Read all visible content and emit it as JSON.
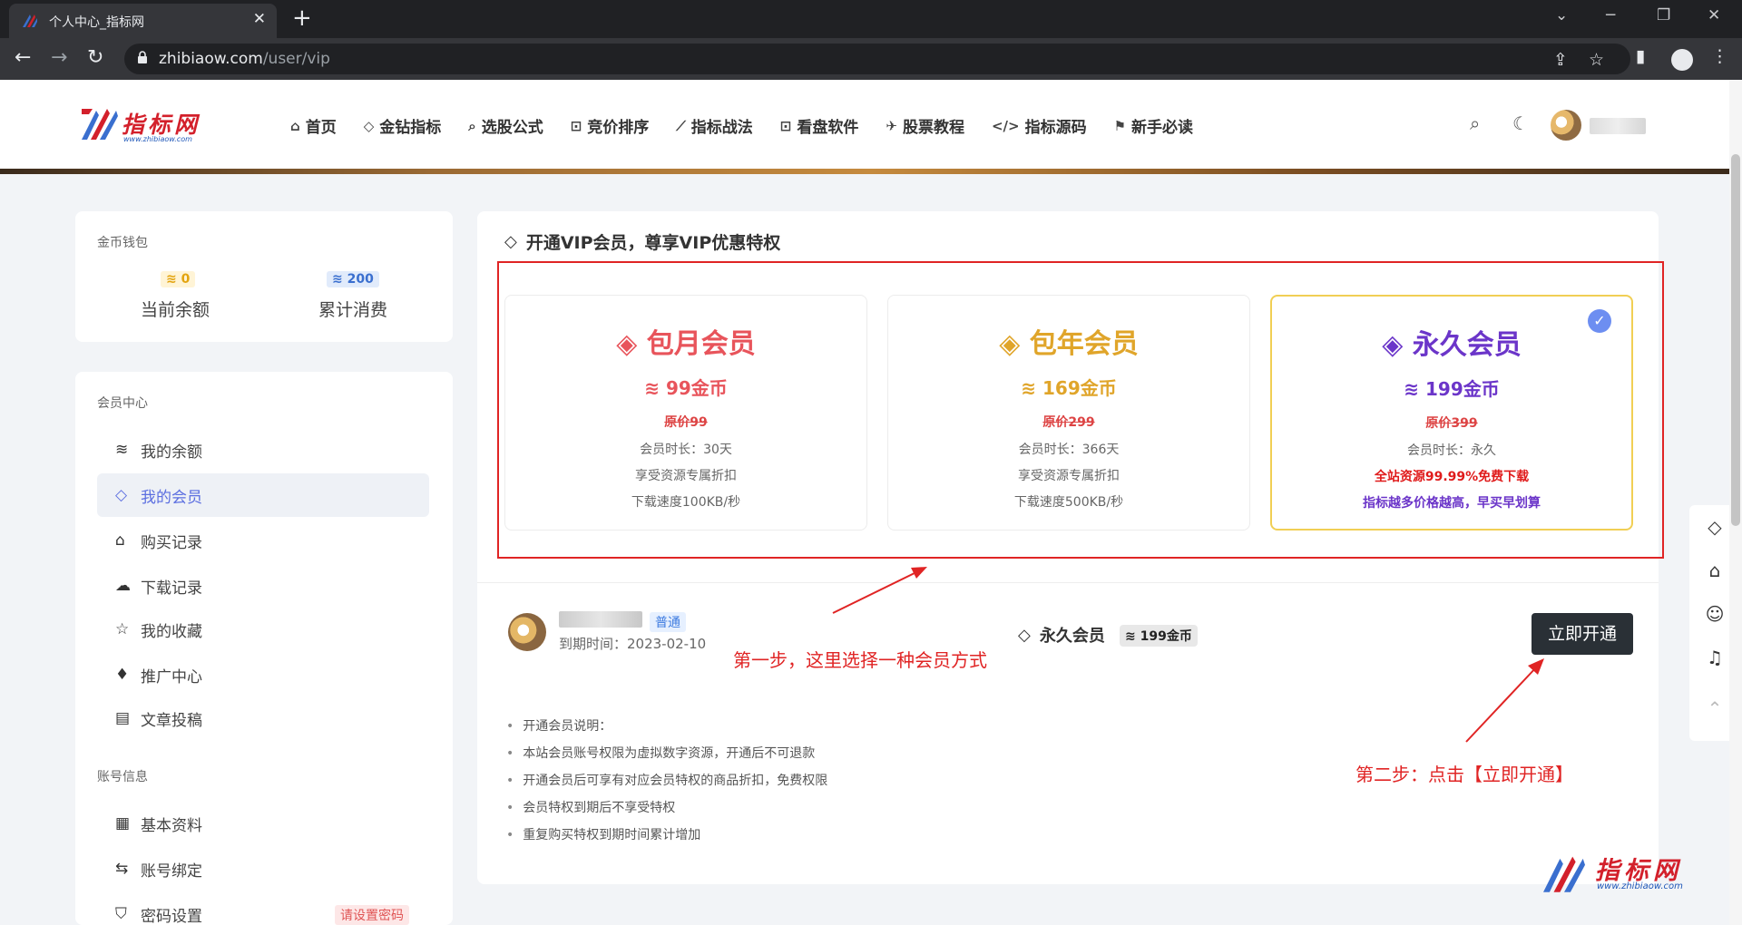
{
  "browser": {
    "tab_title": "个人中心_指标网",
    "tab_close": "✕",
    "new_tab": "+",
    "url_host": "zhibiaow.com",
    "url_path": "/user/vip"
  },
  "header": {
    "logo_name": "指标网",
    "logo_sub": "www.zhibiaow.com",
    "nav": [
      {
        "icon": "⌂",
        "label": "首页"
      },
      {
        "icon": "◇",
        "label": "金钻指标"
      },
      {
        "icon": "⌕",
        "label": "选股公式"
      },
      {
        "icon": "⊡",
        "label": "竞价排序"
      },
      {
        "icon": "⟋",
        "label": "指标战法"
      },
      {
        "icon": "⊡",
        "label": "看盘软件"
      },
      {
        "icon": "✈",
        "label": "股票教程"
      },
      {
        "icon": "</>",
        "label": "指标源码"
      },
      {
        "icon": "⚑",
        "label": "新手必读"
      }
    ]
  },
  "wallet": {
    "title": "金币钱包",
    "balance_value": "0",
    "balance_label": "当前余额",
    "spent_value": "200",
    "spent_label": "累计消费"
  },
  "member_menu": {
    "title": "会员中心",
    "items": [
      {
        "icon": "≋",
        "label": "我的余额"
      },
      {
        "icon": "◇",
        "label": "我的会员"
      },
      {
        "icon": "⌂",
        "label": "购买记录"
      },
      {
        "icon": "☁",
        "label": "下载记录"
      },
      {
        "icon": "☆",
        "label": "我的收藏"
      },
      {
        "icon": "♦",
        "label": "推广中心"
      },
      {
        "icon": "▤",
        "label": "文章投稿"
      }
    ],
    "account_title": "账号信息",
    "account_items": [
      {
        "icon": "▦",
        "label": "基本资料"
      },
      {
        "icon": "⇆",
        "label": "账号绑定"
      },
      {
        "icon": "⛉",
        "label": "密码设置"
      }
    ],
    "pwd_badge": "请设置密码"
  },
  "main": {
    "title": "开通VIP会员，尊享VIP优惠特权",
    "plans": [
      {
        "name": "包月会员",
        "price": "99金币",
        "original": "原价99",
        "lines": [
          "会员时长：30天",
          "享受资源专属折扣",
          "下载速度100KB/秒"
        ],
        "color": "#e8545b"
      },
      {
        "name": "包年会员",
        "price": "169金币",
        "original": "原价299",
        "lines": [
          "会员时长：366天",
          "享受资源专属折扣",
          "下载速度500KB/秒"
        ],
        "color": "#e0a52a"
      },
      {
        "name": "永久会员",
        "price": "199金币",
        "original": "原价399",
        "lines": [
          "会员时长：永久",
          "全站资源99.99%免费下载",
          "指标越多价格越高，早买早划算"
        ],
        "color": "#6b35c9"
      }
    ],
    "user_level": "普通",
    "expire": "到期时间：2023-02-10",
    "selected_plan": "永久会员",
    "selected_price": "199金币",
    "open_button": "立即开通",
    "notes": [
      "开通会员说明：",
      "本站会员账号权限为虚拟数字资源，开通后不可退款",
      "开通会员后可享有对应会员特权的商品折扣，免费权限",
      "会员特权到期后不享受特权",
      "重复购买特权到期时间累计增加"
    ]
  },
  "annotations": {
    "step1": "第一步，这里选择一种会员方式",
    "step2": "第二步：点击【立即开通】"
  },
  "colors": {
    "accent_red": "#e02424",
    "selected_border": "#f1cf54",
    "button_dark": "#2a3036",
    "menu_active": "#5b6ee0"
  }
}
